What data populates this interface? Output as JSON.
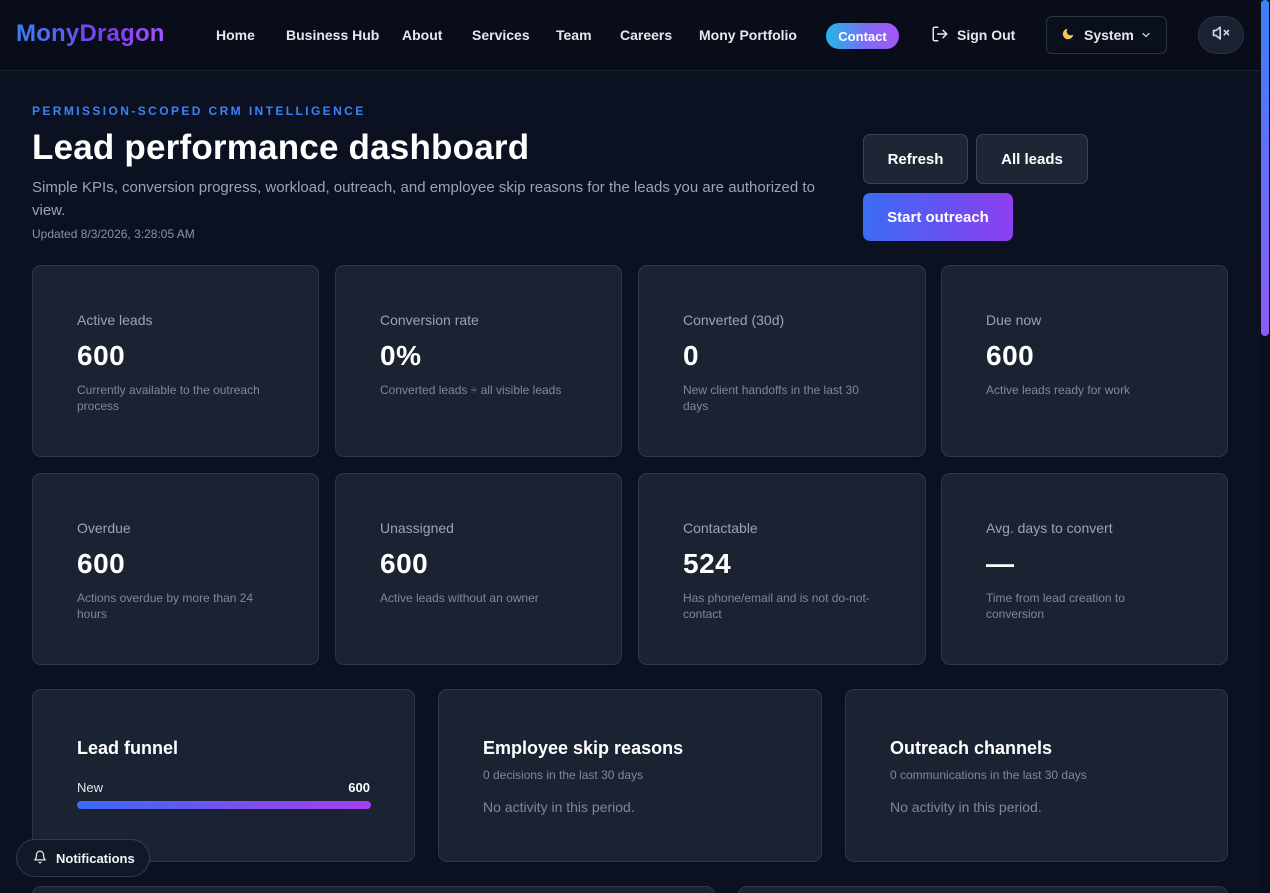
{
  "nav": {
    "brand": "MonyDragon",
    "links": [
      "Home",
      "Business Hub",
      "About",
      "Services",
      "Team",
      "Careers",
      "Mony Portfolio"
    ],
    "contact": "Contact",
    "sign_out": "Sign Out",
    "theme": "System"
  },
  "header": {
    "eyebrow": "PERMISSION-SCOPED CRM INTELLIGENCE",
    "title": "Lead performance dashboard",
    "subtitle": "Simple KPIs, conversion progress, workload, outreach, and employee skip reasons for the leads you are authorized to view.",
    "updated": "Updated 8/3/2026, 3:28:05 AM",
    "refresh": "Refresh",
    "all_leads": "All leads",
    "start_outreach": "Start outreach"
  },
  "kpis": [
    {
      "label": "Active leads",
      "value": "600",
      "desc": "Currently available to the outreach process"
    },
    {
      "label": "Conversion rate",
      "value": "0%",
      "desc": "Converted leads ÷ all visible leads"
    },
    {
      "label": "Converted (30d)",
      "value": "0",
      "desc": "New client handoffs in the last 30 days"
    },
    {
      "label": "Due now",
      "value": "600",
      "desc": "Active leads ready for work"
    },
    {
      "label": "Overdue",
      "value": "600",
      "desc": "Actions overdue by more than 24 hours"
    },
    {
      "label": "Unassigned",
      "value": "600",
      "desc": "Active leads without an owner"
    },
    {
      "label": "Contactable",
      "value": "524",
      "desc": "Has phone/email and is not do-not-contact"
    },
    {
      "label": "Avg. days to convert",
      "value": "—",
      "desc": "Time from lead creation to conversion"
    }
  ],
  "funnel": {
    "title": "Lead funnel",
    "stages": [
      {
        "label": "New",
        "count": "600",
        "fraction": 1.0
      }
    ]
  },
  "skip": {
    "title": "Employee skip reasons",
    "sub": "0 decisions in the last 30 days",
    "empty": "No activity in this period."
  },
  "channels": {
    "title": "Outreach channels",
    "sub": "0 communications in the last 30 days",
    "empty": "No activity in this period."
  },
  "notifications": "Notifications"
}
